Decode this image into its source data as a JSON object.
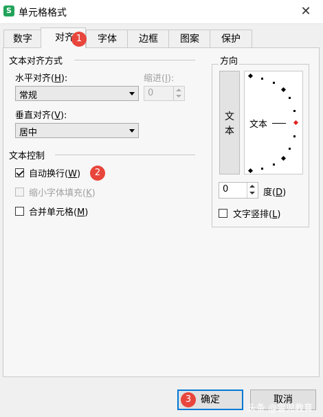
{
  "window": {
    "title": "单元格格式",
    "app_icon_glyph": "S"
  },
  "tabs": [
    {
      "label": "数字",
      "active": false
    },
    {
      "label": "对齐",
      "active": true
    },
    {
      "label": "字体",
      "active": false
    },
    {
      "label": "边框",
      "active": false
    },
    {
      "label": "图案",
      "active": false
    },
    {
      "label": "保护",
      "active": false
    }
  ],
  "alignment": {
    "group_label": "文本对齐方式",
    "horizontal": {
      "label_prefix": "水平对齐(",
      "label_key": "H",
      "label_suffix": "):",
      "value": "常规"
    },
    "indent": {
      "label_prefix": "缩进(",
      "label_key": "I",
      "label_suffix": "):",
      "value": "0"
    },
    "vertical": {
      "label_prefix": "垂直对齐(",
      "label_key": "V",
      "label_suffix": "):",
      "value": "居中"
    }
  },
  "text_control": {
    "group_label": "文本控制",
    "wrap": {
      "label_prefix": "自动换行(",
      "label_key": "W",
      "label_suffix": ")",
      "checked": true
    },
    "shrink": {
      "label_prefix": "缩小字体填充(",
      "label_key": "K",
      "label_suffix": ")",
      "checked": false,
      "disabled": true
    },
    "merge": {
      "label_prefix": "合并单元格(",
      "label_key": "M",
      "label_suffix": ")",
      "checked": false
    }
  },
  "orientation": {
    "group_label": "方向",
    "vertical_text_char1": "文",
    "vertical_text_char2": "本",
    "dial_text": "文本",
    "degree_value": "0",
    "degree_label_prefix": "度(",
    "degree_label_key": "D",
    "degree_label_suffix": ")",
    "vertical_layout": {
      "label_prefix": "文字竖排(",
      "label_key": "L",
      "label_suffix": ")",
      "checked": false
    }
  },
  "buttons": {
    "ok": "确定",
    "cancel": "取消"
  },
  "badges": {
    "b1": "1",
    "b2": "2",
    "b3": "3"
  },
  "watermark": "头条 @雪児教育",
  "colors": {
    "accent": "#0078d7",
    "badge": "#e8463c",
    "app_icon": "#21a35a"
  }
}
